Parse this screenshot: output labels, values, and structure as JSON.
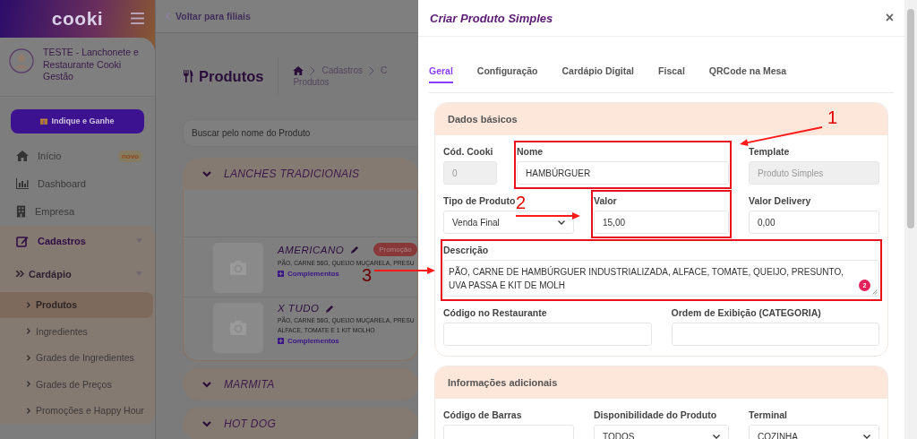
{
  "sidebar": {
    "logo": "cooki",
    "account": "TESTE - Lanchonete e Restaurante Cooki Gestão",
    "referral_button": "Indique e Ganhe",
    "items": [
      {
        "label": "Início",
        "badge": "novo"
      },
      {
        "label": "Dashboard"
      },
      {
        "label": "Empresa"
      },
      {
        "label": "Cadastros",
        "expanded": true,
        "children": [
          {
            "label": "Cardápio",
            "expanded": true,
            "children": [
              {
                "label": "Produtos",
                "selected": true
              },
              {
                "label": "Ingredientes",
                "selected": false
              },
              {
                "label": "Grades de Ingredientes",
                "selected": false
              },
              {
                "label": "Grades de Preços",
                "selected": false
              },
              {
                "label": "Promoções e Happy Hour",
                "selected": false
              }
            ]
          }
        ]
      }
    ]
  },
  "main": {
    "back_link": "Voltar para filiais",
    "title": "Produtos",
    "breadcrumb": [
      "Cadastros",
      "C",
      "Produtos"
    ],
    "search": {
      "placeholder": "Buscar pelo nome do Produto"
    },
    "categories": [
      {
        "name": "LANCHES TRADICIONAIS",
        "products": [
          {
            "name": "AMERICANO",
            "badge": "Promoção",
            "description": [
              "PÃO, CARNE 56G, QUEIJO MUÇARELA, PRESU"
            ],
            "link": "Complementos"
          },
          {
            "name": "X TUDO",
            "description": [
              "PÃO, CARNE 56G, QUEIJO MUÇARELA, PRESU",
              "ALFACE, TOMATE E 1 KIT MOLHO"
            ],
            "link": "Complementos"
          }
        ]
      },
      {
        "name": "MARMITA"
      },
      {
        "name": "HOT DOG"
      }
    ]
  },
  "modal": {
    "title": "Criar Produto Simples",
    "close": "×",
    "tabs": [
      {
        "label": "Geral",
        "selected": true
      },
      {
        "label": "Configuração",
        "selected": false
      },
      {
        "label": "Cardápio Digital",
        "selected": false
      },
      {
        "label": "Fiscal",
        "selected": false
      },
      {
        "label": "QRCode na Mesa",
        "selected": false
      }
    ],
    "sections": [
      {
        "title": "Dados básicos",
        "rows": [
          {
            "fields": [
              {
                "label": "Cód. Cooki",
                "kind": "text",
                "value": "0",
                "disabled": true,
                "highlighted": false
              },
              {
                "label": "Nome",
                "kind": "text",
                "value": "HAMBÚRGUER",
                "disabled": false,
                "highlighted": true
              },
              {
                "label": "Template",
                "kind": "text",
                "value": "Produto Simples",
                "disabled": true,
                "highlighted": false
              }
            ]
          },
          {
            "fields": [
              {
                "label": "Tipo de Produto",
                "kind": "select",
                "value": "Venda Final",
                "disabled": false,
                "highlighted": false
              },
              {
                "label": "Valor",
                "kind": "text",
                "value": "15,00",
                "disabled": false,
                "highlighted": true
              },
              {
                "label": "Valor Delivery",
                "kind": "text",
                "value": "0,00",
                "disabled": false,
                "highlighted": false
              }
            ]
          },
          {
            "fields": [
              {
                "label": "Descrição",
                "kind": "textarea",
                "value": "PÃO, CARNE DE HAMBÚRGUER INDUSTRIALIZADA, ALFACE, TOMATE, QUEIJO, PRESUNTO, UVA PASSA E KIT DE MOLH",
                "badge": "2",
                "disabled": false,
                "highlighted": true
              }
            ]
          },
          {
            "fields": [
              {
                "label": "Código no Restaurante",
                "kind": "text",
                "disabled": false,
                "highlighted": false
              },
              {
                "label": "Ordem de Exibição (CATEGORIA)",
                "kind": "text",
                "disabled": false,
                "highlighted": false
              }
            ]
          }
        ]
      },
      {
        "title": "Informações adicionais",
        "rows": [
          {
            "fields": [
              {
                "label": "Código de Barras",
                "kind": "text",
                "disabled": false,
                "highlighted": false
              },
              {
                "label": "Disponibilidade do Produto",
                "kind": "select",
                "value": "TODOS",
                "disabled": false,
                "highlighted": false
              },
              {
                "label": "Terminal",
                "kind": "select",
                "value": "COZINHA",
                "disabled": false,
                "highlighted": false
              }
            ]
          }
        ]
      }
    ]
  },
  "annotations": [
    {
      "label": "1"
    },
    {
      "label": "2"
    },
    {
      "label": "3"
    }
  ]
}
